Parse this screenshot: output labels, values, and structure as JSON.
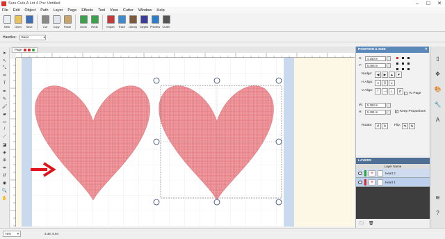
{
  "window": {
    "title": "Sure Cuts A Lot 4 Pro: Untitled",
    "min": "–",
    "max": "☐",
    "close": "✕"
  },
  "menu": [
    "File",
    "Edit",
    "Object",
    "Path",
    "Layer",
    "Page",
    "Effects",
    "Text",
    "View",
    "Cutter",
    "Window",
    "Help"
  ],
  "toolbar": [
    {
      "label": "New",
      "icon": "new-document-icon",
      "color": "#e9eef5"
    },
    {
      "label": "Open",
      "icon": "open-folder-icon",
      "color": "#e8c15a"
    },
    {
      "label": "Save",
      "icon": "save-icon",
      "color": "#3d6fb6"
    },
    {
      "label": "Cut",
      "icon": "scissors-icon",
      "color": "#888888"
    },
    {
      "label": "Copy",
      "icon": "copy-icon",
      "color": "#e2e6ee"
    },
    {
      "label": "Paste",
      "icon": "paste-icon",
      "color": "#c9a46b"
    },
    {
      "label": "Undo",
      "icon": "undo-icon",
      "color": "#3aa148"
    },
    {
      "label": "Redo",
      "icon": "redo-icon",
      "color": "#3aa148"
    },
    {
      "label": "Import",
      "icon": "import-icon",
      "color": "#c43a3a"
    },
    {
      "label": "Trace",
      "icon": "trace-icon",
      "color": "#3c8ad1"
    },
    {
      "label": "Library",
      "icon": "library-icon",
      "color": "#7a5a3a"
    },
    {
      "label": "Glyphs",
      "icon": "glyphs-icon",
      "color": "#3c3c9a"
    },
    {
      "label": "Preview",
      "icon": "preview-icon",
      "color": "#2d7ec9"
    },
    {
      "label": "Cutter",
      "icon": "cutter-icon",
      "color": "#555555"
    }
  ],
  "handles": {
    "label": "Handles:",
    "value": "Basic"
  },
  "doc_tab": {
    "label": "Page"
  },
  "position_panel": {
    "title": "POSITION & SIZE",
    "x_label": "X:",
    "x_value": "4.150 in",
    "y_label": "Y:",
    "y_value": "5.456 in",
    "nudge_label": "Nudge:",
    "halign_label": "H Align:",
    "valign_label": "V Align:",
    "to_page_label": "To Page",
    "w_label": "W:",
    "w_value": "5.393 in",
    "h_label": "H:",
    "h_value": "5.491 in",
    "keep_proportions_label": "Keep Proportions",
    "keep_proportions": true,
    "rotate_label": "Rotate:",
    "flip_label": "Flip:"
  },
  "layers_panel": {
    "title": "LAYERS",
    "column": "Layer Name",
    "rows": [
      {
        "name": "Heart 2",
        "color": "#27a337",
        "selected": false
      },
      {
        "name": "Heart 1",
        "color": "#d62b2b",
        "selected": true
      }
    ]
  },
  "status": {
    "zoom": "75%",
    "coords": "3.48, 6.94"
  },
  "colors": {
    "heart_fill": "#e88a8e",
    "heart_grid": "#d85a62",
    "canvas_bg": "#fdf8e6",
    "page_bg": "#ffffff",
    "margin_blue": "#c9d9ee",
    "arrow": "#e0141a"
  }
}
